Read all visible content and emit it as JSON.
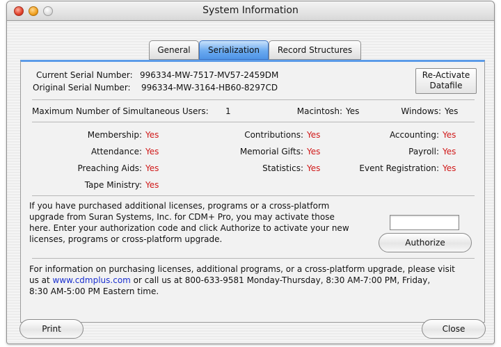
{
  "window": {
    "title": "System Information"
  },
  "tabs": [
    {
      "label": "General"
    },
    {
      "label": "Serialization"
    },
    {
      "label": "Record Structures"
    }
  ],
  "serial": {
    "current_label": "Current Serial Number:",
    "current_value": "996334-MW-7517-MV57-2459DM",
    "original_label": "Original Serial Number:",
    "original_value": "996334-MW-3164-HB60-8297CD",
    "reactivate_line1": "Re-Activate",
    "reactivate_line2": "Datafile"
  },
  "users": {
    "max_label": "Maximum Number of Simultaneous Users:",
    "max_value": "1",
    "mac_label": "Macintosh:",
    "mac_value": "Yes",
    "win_label": "Windows:",
    "win_value": "Yes"
  },
  "modules": {
    "membership": {
      "label": "Membership:",
      "value": "Yes"
    },
    "attendance": {
      "label": "Attendance:",
      "value": "Yes"
    },
    "preaching": {
      "label": "Preaching Aids:",
      "value": "Yes"
    },
    "tape": {
      "label": "Tape Ministry:",
      "value": "Yes"
    },
    "contributions": {
      "label": "Contributions:",
      "value": "Yes"
    },
    "memorial": {
      "label": "Memorial Gifts:",
      "value": "Yes"
    },
    "statistics": {
      "label": "Statistics:",
      "value": "Yes"
    },
    "accounting": {
      "label": "Accounting:",
      "value": "Yes"
    },
    "payroll": {
      "label": "Payroll:",
      "value": "Yes"
    },
    "event": {
      "label": "Event Registration:",
      "value": "Yes"
    }
  },
  "authorize": {
    "line1": "If you have purchased additional licenses, programs or a cross-platform",
    "line2": "upgrade from Suran Systems, Inc. for CDM+ Pro, you may activate those",
    "line3": "here. Enter your authorization code and click Authorize to activate your new",
    "line4": "licenses, programs or cross-platform upgrade.",
    "input_value": "",
    "button_label": "Authorize"
  },
  "info": {
    "line1": "For information on purchasing licenses, additional programs, or a cross-platform upgrade, please visit",
    "line2_pre": "us at ",
    "line2_link": "www.cdmplus.com",
    "line2_post": " or call us at 800-633-9581 Monday-Thursday, 8:30 AM-7:00 PM, Friday,",
    "line3": "8:30 AM-5:00 PM Eastern time."
  },
  "footer": {
    "print_label": "Print",
    "close_label": "Close"
  },
  "colors": {
    "yes": "#d01818",
    "link": "#1a2fcf",
    "tab_active": "#4f94e6"
  }
}
